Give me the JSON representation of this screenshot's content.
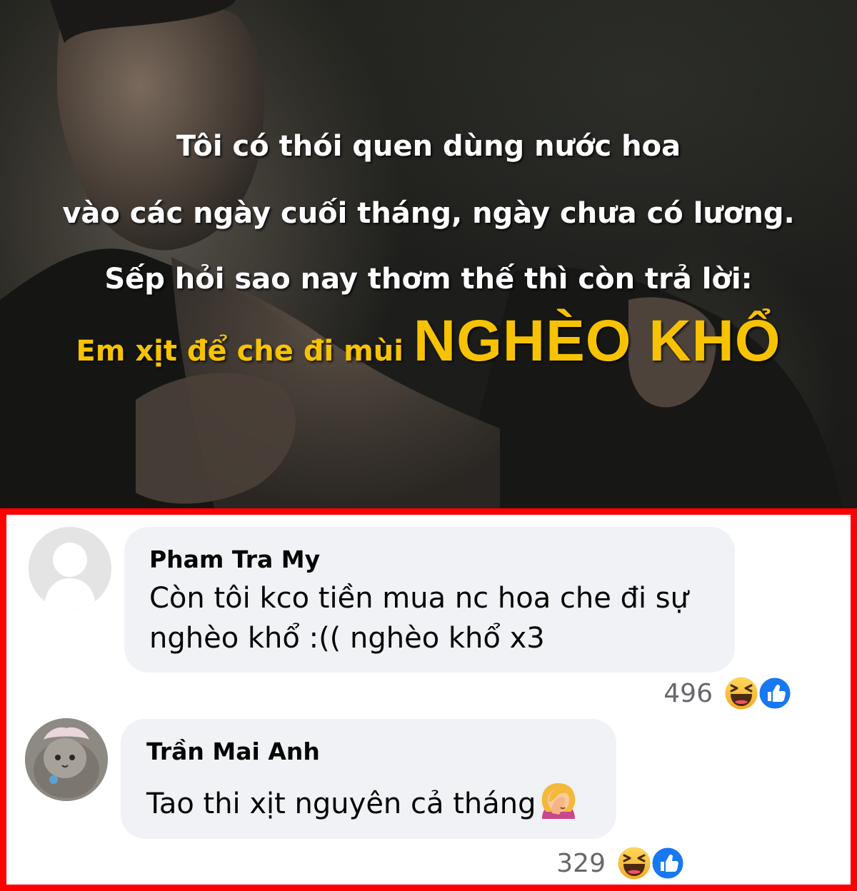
{
  "banner": {
    "line1": "Tôi có thói quen dùng nước hoa",
    "line2": "vào các ngày cuối tháng, ngày chưa có lương.",
    "line3": "Sếp hỏi sao nay thơm thế thì còn trả lời:",
    "line4_prefix": "Em xịt để che đi mùi ",
    "line4_emphasis": "NGHÈO KHỔ",
    "colors": {
      "highlight": "#f7c300",
      "text": "#ffffff"
    }
  },
  "comments": [
    {
      "author": "Pham Tra My",
      "text": "Còn tôi kco tiền mua nc hoa che đi sự nghèo khổ :(( nghèo khổ x3",
      "reaction_count": "496",
      "reactions": [
        "haha-icon",
        "like-icon"
      ],
      "avatar": "default-avatar-icon"
    },
    {
      "author": "Trần Mai Anh",
      "text": "Tao thi xịt nguyên cả tháng",
      "emoji": "woman-facepalming-icon",
      "reaction_count": "329",
      "reactions": [
        "haha-icon",
        "like-icon"
      ],
      "avatar": "cat-photo-avatar"
    }
  ],
  "frame_color": "#ff0000",
  "like_color": "#1877f2"
}
